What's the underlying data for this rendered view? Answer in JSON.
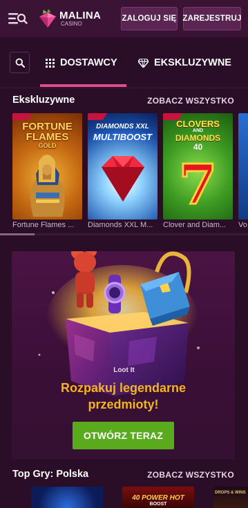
{
  "header": {
    "logo_name": "MALINA",
    "logo_sub": "CASINO",
    "login_label": "ZALOGUJ SIĘ",
    "register_label": "ZAREJESTRUJ"
  },
  "nav": {
    "tabs": [
      {
        "label": "DOSTAWCY",
        "icon": "grid-icon",
        "active": true
      },
      {
        "label": "EKSKLUZYWNE",
        "icon": "diamond-icon",
        "active": false
      }
    ]
  },
  "exclusive_section": {
    "title": "Ekskluzywne",
    "see_all": "ZOBACZ WSZYSTKO",
    "games": [
      {
        "label": "Fortune Flames ...",
        "art_line1": "FORTUNE",
        "art_line2": "FLAMES",
        "art_line3": "GOLD"
      },
      {
        "label": "Diamonds XXL M...",
        "art_line1": "DIAMONDS XXL",
        "art_line2": "MULTIBOOST"
      },
      {
        "label": "Clover and Diam...",
        "art_line1": "CLOVERS",
        "art_line2": "AND",
        "art_line3": "DIAMONDS",
        "art_line4": "40",
        "art_big": "7"
      },
      {
        "label": "Vo"
      }
    ]
  },
  "promo": {
    "brand": "Loot It",
    "title_line1": "Rozpakuj legendarne",
    "title_line2": "przedmioty!",
    "cta": "OTWÓRZ TERAZ"
  },
  "top_section": {
    "title": "Top Gry: Polska",
    "see_all": "ZOBACZ WSZYSTKO",
    "games": [
      {
        "art_text": ""
      },
      {
        "art_text": "40 POWER HOT",
        "art_sub": "BOOST"
      },
      {
        "art_text": "DROPS & WINS"
      }
    ]
  },
  "colors": {
    "background": "#2a0d27",
    "header": "#3a1335",
    "accent": "#e14b8f",
    "promo_title": "#f5b41c",
    "cta": "#5aaa1d"
  }
}
